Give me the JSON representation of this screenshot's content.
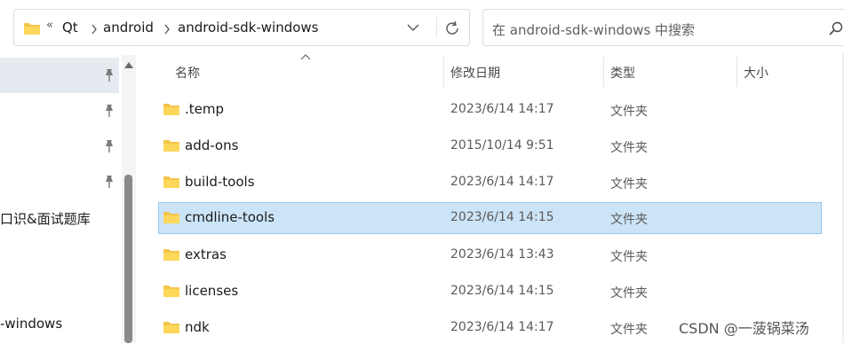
{
  "address_bar": {
    "overflow": "«",
    "crumbs": [
      "Qt",
      "android",
      "android-sdk-windows"
    ]
  },
  "search": {
    "placeholder": "在 android-sdk-windows 中搜索"
  },
  "nav": {
    "items": [
      {
        "label": "",
        "pinned": true,
        "selected": true
      },
      {
        "label": "",
        "pinned": true,
        "selected": false
      },
      {
        "label": "",
        "pinned": true,
        "selected": false
      },
      {
        "label": "",
        "pinned": true,
        "selected": false
      },
      {
        "label": "口识&面试题库",
        "pinned": false,
        "selected": false
      },
      {
        "label": "-windows",
        "pinned": false,
        "selected": false
      }
    ]
  },
  "columns": {
    "name": "名称",
    "modified": "修改日期",
    "type": "类型",
    "size": "大小"
  },
  "files": [
    {
      "name": ".temp",
      "modified": "2023/6/14 14:17",
      "type": "文件夹",
      "size": "",
      "selected": false
    },
    {
      "name": "add-ons",
      "modified": "2015/10/14 9:51",
      "type": "文件夹",
      "size": "",
      "selected": false
    },
    {
      "name": "build-tools",
      "modified": "2023/6/14 14:17",
      "type": "文件夹",
      "size": "",
      "selected": false
    },
    {
      "name": "cmdline-tools",
      "modified": "2023/6/14 14:15",
      "type": "文件夹",
      "size": "",
      "selected": true
    },
    {
      "name": "extras",
      "modified": "2023/6/14 13:43",
      "type": "文件夹",
      "size": "",
      "selected": false
    },
    {
      "name": "licenses",
      "modified": "2023/6/14 14:15",
      "type": "文件夹",
      "size": "",
      "selected": false
    },
    {
      "name": "ndk",
      "modified": "2023/6/14 14:17",
      "type": "文件夹",
      "size": "",
      "selected": false
    }
  ],
  "watermark": "CSDN @一菠锅菜汤",
  "colors": {
    "selected_bg": "#cce4f7",
    "selected_border": "#99c9ef",
    "folder": "#f4c54a",
    "nav_selected": "#e5eaf1"
  },
  "icons": {
    "folder": "folder-icon",
    "pin": "pin-icon",
    "refresh": "refresh-icon",
    "search": "search-icon",
    "chevron": "chevron-right-icon",
    "dropdown": "chevron-down-icon"
  }
}
